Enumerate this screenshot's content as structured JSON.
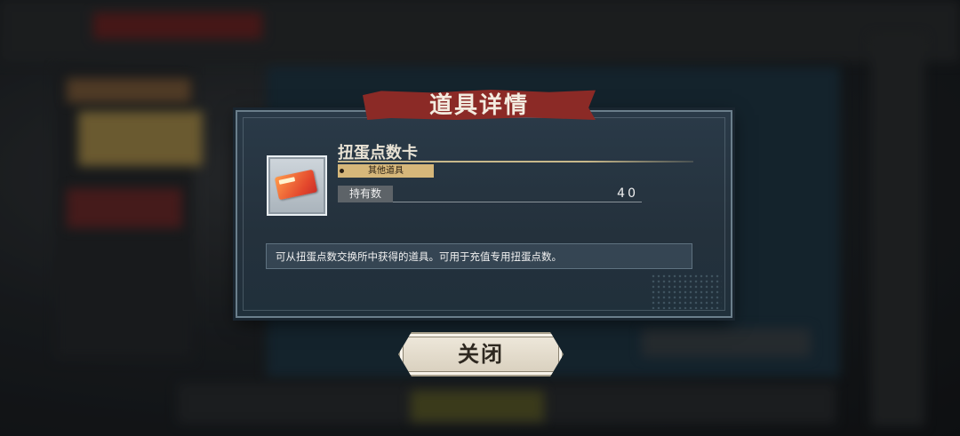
{
  "dialog": {
    "title": "道具详情",
    "item_name": "扭蛋点数卡",
    "category": "其他道具",
    "owned_label": "持有数",
    "owned_value": "40",
    "description": "可从扭蛋点数交换所中获得的道具。可用于充值专用扭蛋点数。",
    "close_label": "关闭",
    "item_icon": "gacha-point-card-icon"
  },
  "colors": {
    "banner": "#8b2a26",
    "panel": "#24313c",
    "category_tag": "#d6b77a",
    "close_button": "#e8e1d3"
  }
}
